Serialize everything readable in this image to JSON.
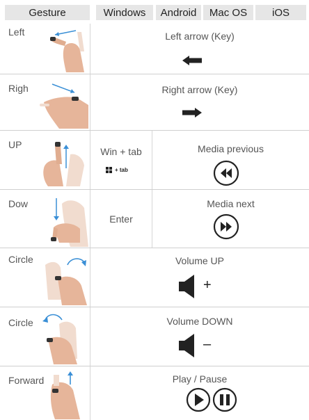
{
  "header": {
    "gesture": "Gesture",
    "windows": "Windows",
    "android": "Android",
    "macos": "Mac OS",
    "ios": "iOS"
  },
  "rows": [
    {
      "gesture": "Left",
      "action": "Left arrow (Key)",
      "icon": "arrow-left-icon"
    },
    {
      "gesture": "Righ",
      "action": "Right arrow (Key)",
      "icon": "arrow-right-icon"
    },
    {
      "gesture": "UP",
      "windows": "Win + tab",
      "windows_key": "+ tab",
      "action": "Media previous",
      "icon": "media-previous-icon"
    },
    {
      "gesture": "Dow",
      "windows": "Enter",
      "action": "Media next",
      "icon": "media-next-icon"
    },
    {
      "gesture": "Circle",
      "action": "Volume UP",
      "icon": "volume-up-icon",
      "sign": "+"
    },
    {
      "gesture": "Circle",
      "action": "Volume DOWN",
      "icon": "volume-down-icon",
      "sign": "–"
    },
    {
      "gesture": "Forward",
      "action": "Play / Pause",
      "icon": "play-pause-icon"
    }
  ],
  "colors": {
    "header_bg": "#e6e6e6",
    "gesture_arrow": "#3a8fd6",
    "icon": "#222222",
    "hand": "#e6b59a"
  }
}
